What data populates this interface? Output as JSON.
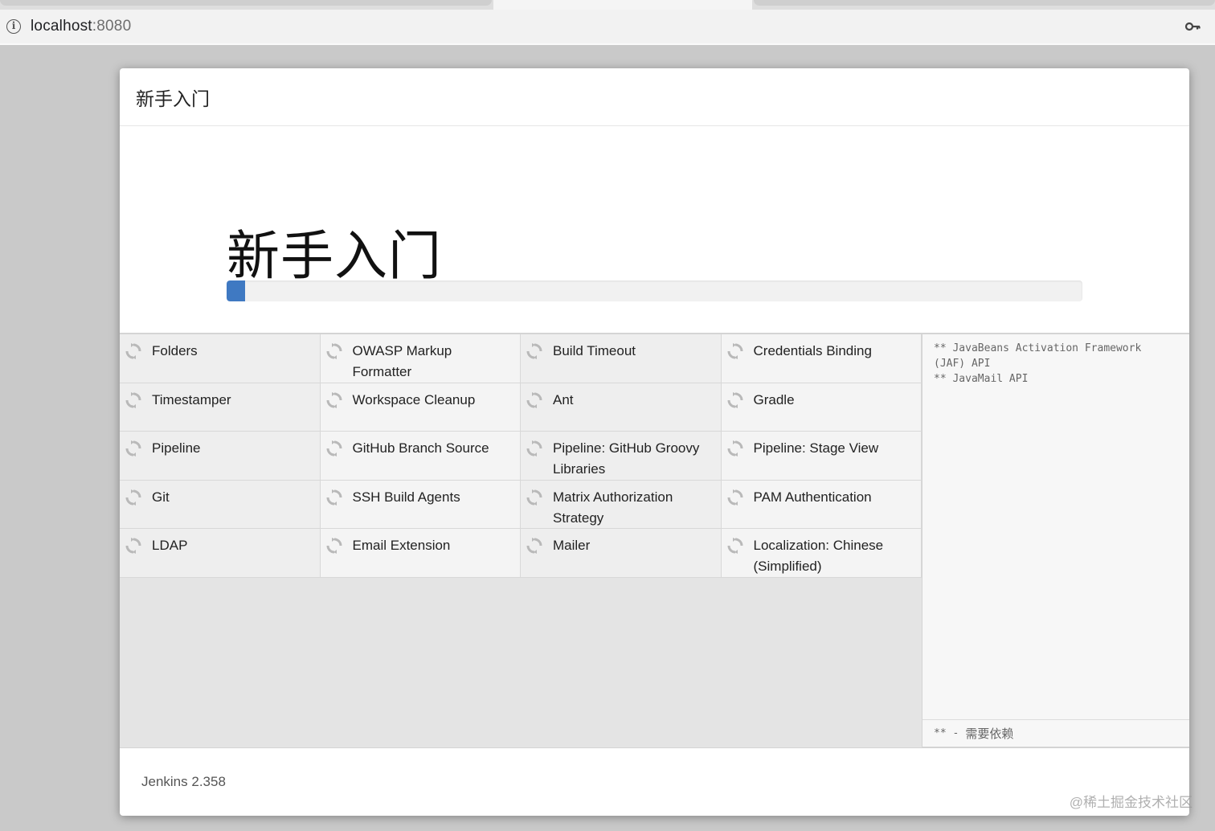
{
  "browser": {
    "url_host": "localhost",
    "url_port": ":8080"
  },
  "dialog": {
    "header_title": "新手入门",
    "hero_title": "新手入门",
    "progress_fraction": 0.022,
    "accent_color": "#3f79c2"
  },
  "plugins": [
    {
      "name": "Folders"
    },
    {
      "name": "OWASP Markup Formatter"
    },
    {
      "name": "Build Timeout"
    },
    {
      "name": "Credentials Binding"
    },
    {
      "name": "Timestamper"
    },
    {
      "name": "Workspace Cleanup"
    },
    {
      "name": "Ant"
    },
    {
      "name": "Gradle"
    },
    {
      "name": "Pipeline"
    },
    {
      "name": "GitHub Branch Source"
    },
    {
      "name": "Pipeline: GitHub Groovy Libraries"
    },
    {
      "name": "Pipeline: Stage View"
    },
    {
      "name": "Git"
    },
    {
      "name": "SSH Build Agents"
    },
    {
      "name": "Matrix Authorization Strategy"
    },
    {
      "name": "PAM Authentication"
    },
    {
      "name": "LDAP"
    },
    {
      "name": "Email Extension"
    },
    {
      "name": "Mailer"
    },
    {
      "name": "Localization: Chinese (Simplified)"
    }
  ],
  "log": {
    "text": "** JavaBeans Activation Framework\n(JAF) API\n** JavaMail API",
    "legend_marker": "** -",
    "legend_text": "需要依赖"
  },
  "footer": {
    "version": "Jenkins 2.358"
  },
  "watermark": "@稀土掘金技术社区",
  "icons": {
    "info": "info-circle-icon",
    "key": "key-icon",
    "plugin_status": "refresh-spinner-icon"
  }
}
